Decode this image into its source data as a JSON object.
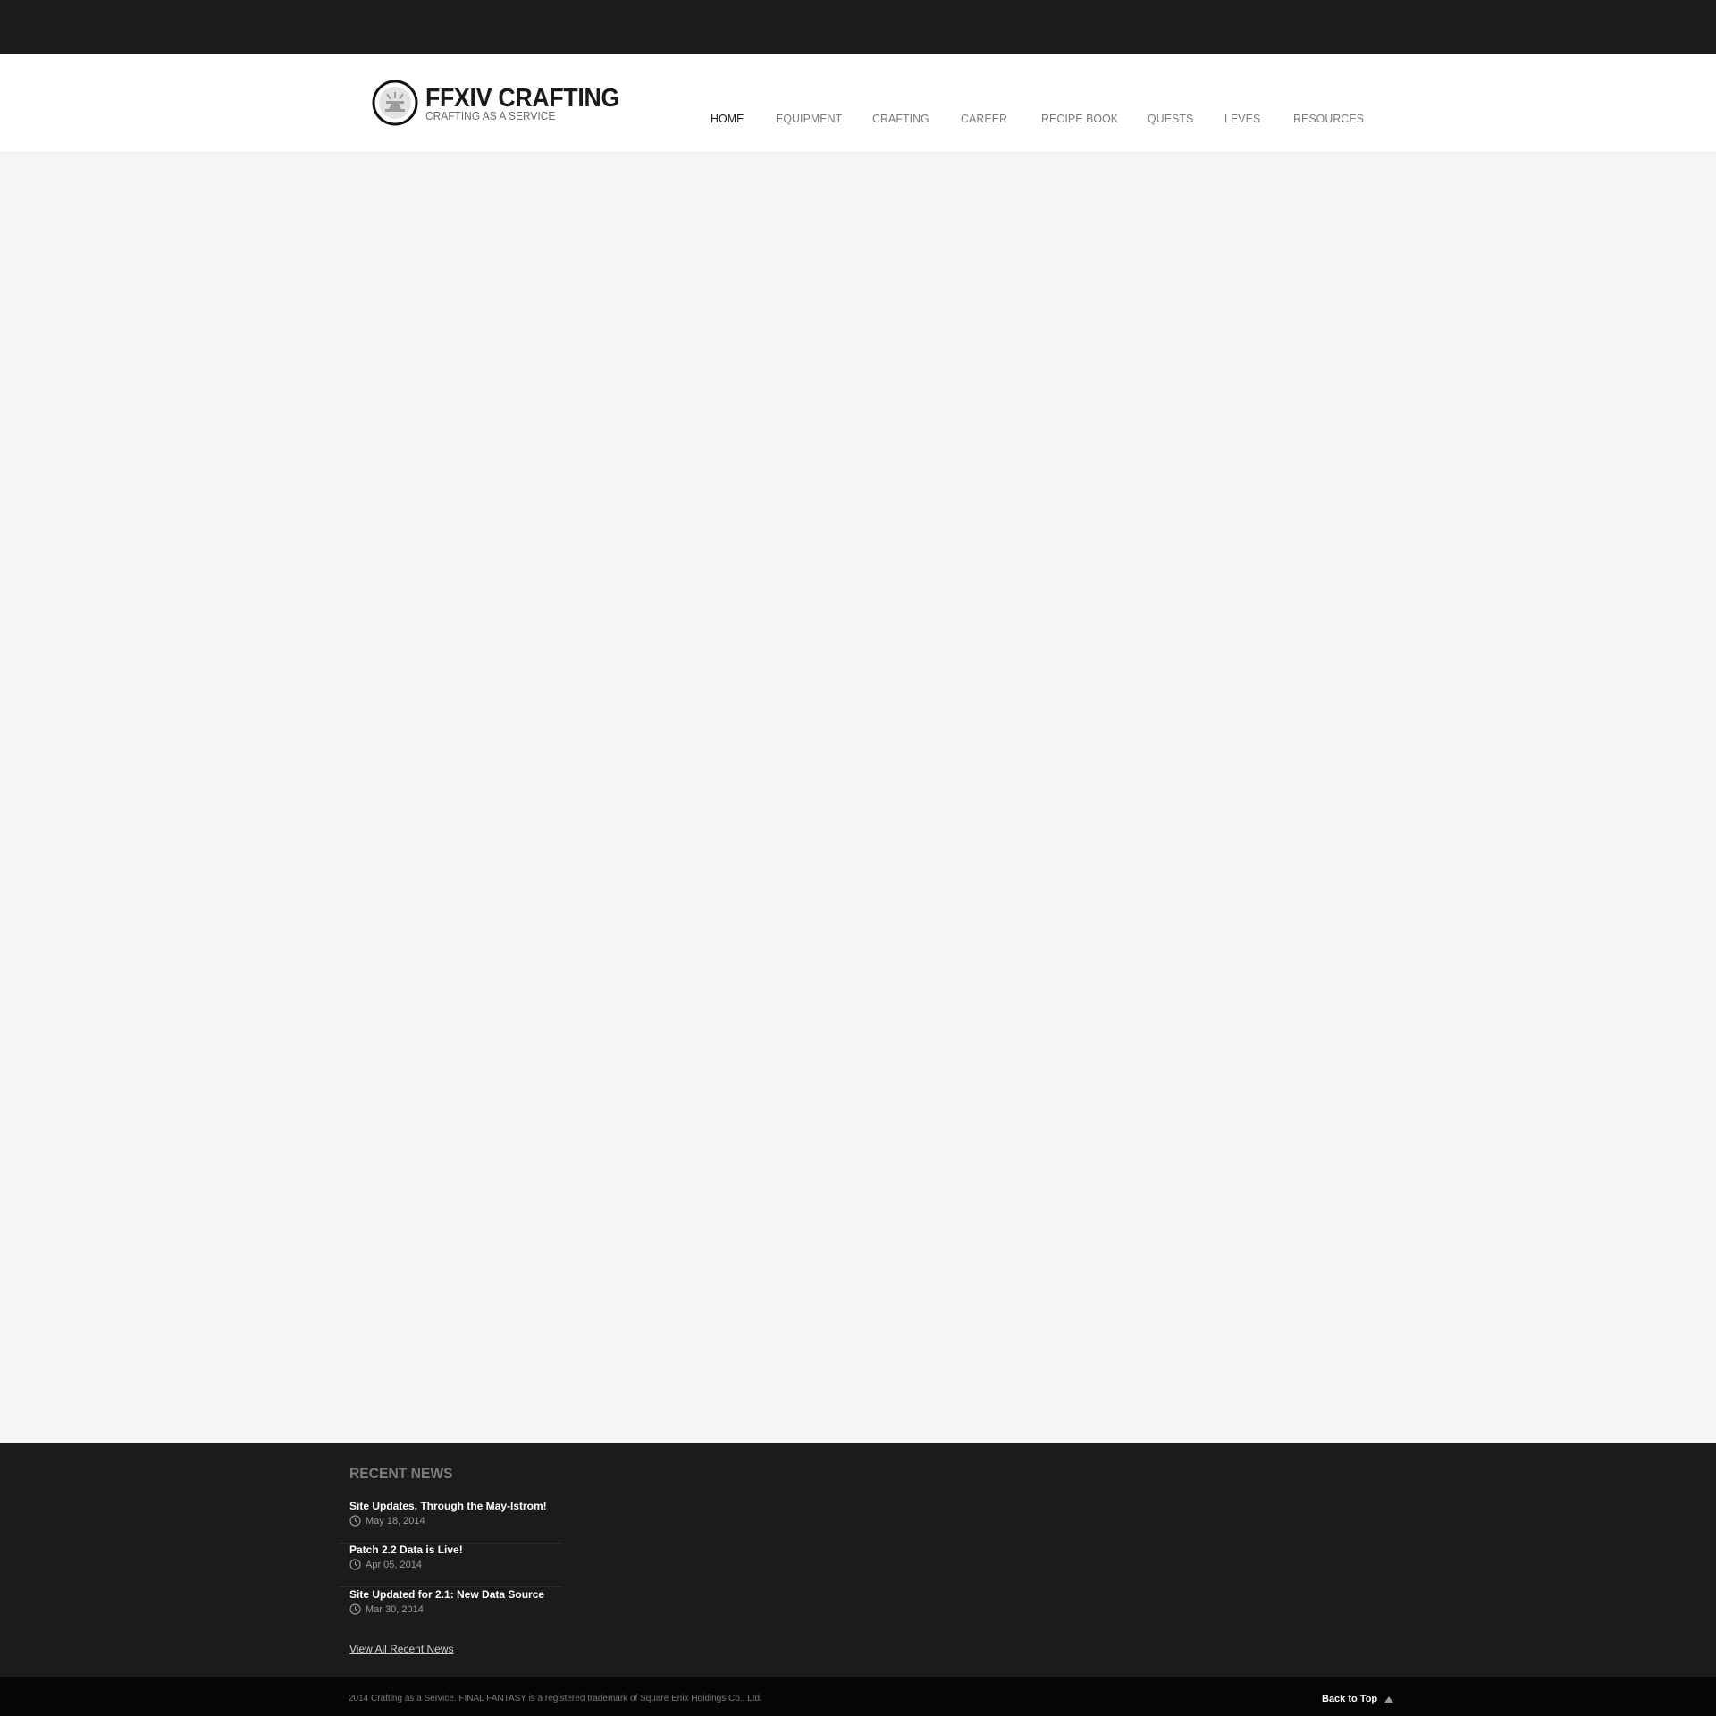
{
  "site": {
    "title": "FFXIV CRAFTING",
    "tagline": "CRAFTING AS A SERVICE"
  },
  "nav": {
    "items": [
      {
        "label": "HOME",
        "active": true
      },
      {
        "label": "EQUIPMENT",
        "active": false
      },
      {
        "label": "CRAFTING",
        "active": false
      },
      {
        "label": "CAREER",
        "active": false
      },
      {
        "label": "RECIPE BOOK",
        "active": false
      },
      {
        "label": "QUESTS",
        "active": false
      },
      {
        "label": "LEVES",
        "active": false
      },
      {
        "label": "RESOURCES",
        "active": false
      }
    ]
  },
  "footer": {
    "news_heading": "RECENT NEWS",
    "news": [
      {
        "title": "Site Updates, Through the May-lstrom!",
        "date": "May 18, 2014"
      },
      {
        "title": "Patch 2.2 Data is Live!",
        "date": "Apr 05, 2014"
      },
      {
        "title": "Site Updated for 2.1: New Data Source",
        "date": "Mar 30, 2014"
      }
    ],
    "view_all": "View All Recent News",
    "copyright": "2014 Crafting as a Service. FINAL FANTASY is a registered trademark of Square Enix Holdings Co., Ltd.",
    "back_to_top": "Back to Top"
  },
  "colors": {
    "dark_bar": "#1a1b1d",
    "content_bg": "#f5f5f5",
    "nav_active": "#1a1a1a",
    "nav_inactive": "#7a7a7a"
  },
  "icons": [
    "anvil-logo-icon",
    "clock-icon",
    "arrow-up-icon"
  ]
}
